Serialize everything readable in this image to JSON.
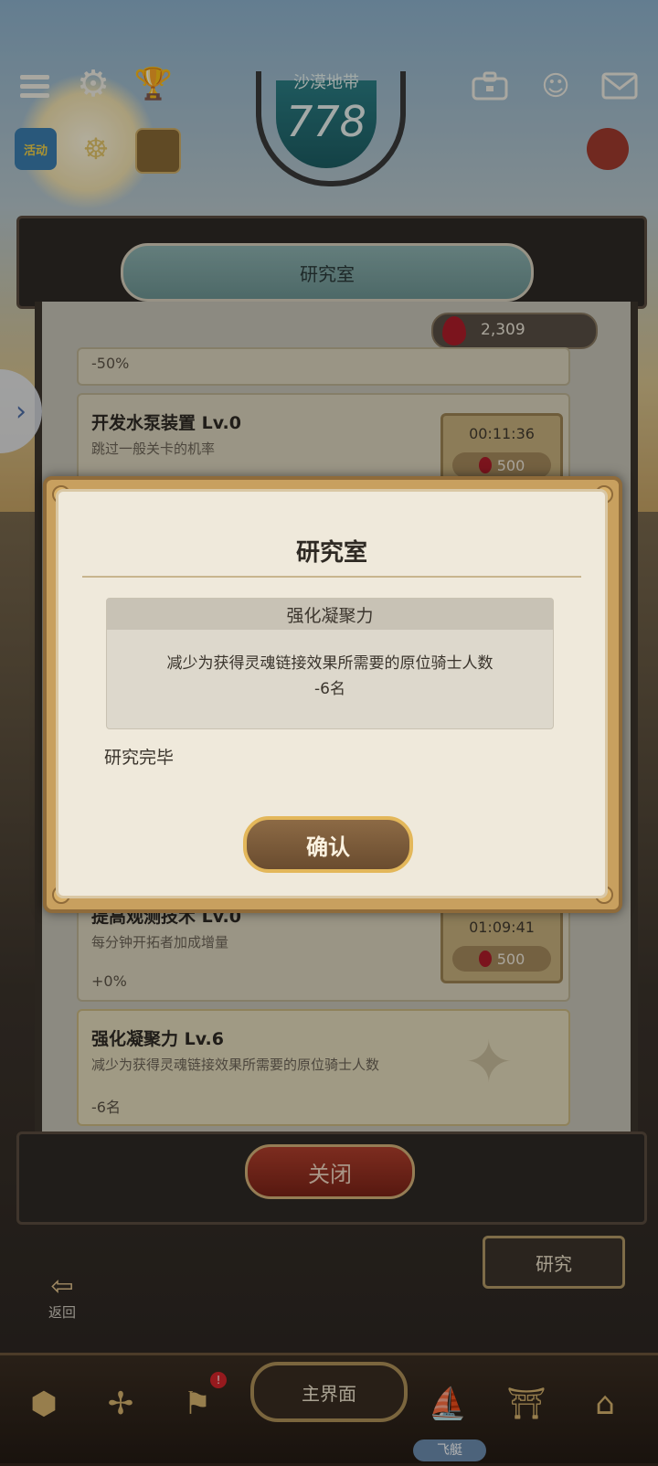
{
  "zone": {
    "name": "沙漠地带",
    "level": "778"
  },
  "top_icons": {
    "menu": "menu-icon",
    "settings": "gear-icon",
    "trophy": "trophy-icon",
    "toolbox": "toolbox-icon",
    "friends": "friends-icon",
    "mail": "mail-icon"
  },
  "event_label": "活动",
  "lab": {
    "title": "研究室",
    "currency": "2,309",
    "items": [
      {
        "value": "-50%"
      },
      {
        "title": "开发水泵装置 Lv.0",
        "desc": "跳过一般关卡的机率",
        "timer": "00:11:36",
        "cost": "500"
      },
      {
        "title": "提高观测技术 Lv.0",
        "desc": "每分钟开拓者加成增量",
        "value": "+0%",
        "timer": "01:09:41",
        "cost": "500"
      },
      {
        "title": "强化凝聚力 Lv.6",
        "desc": "减少为获得灵魂链接效果所需要的原位骑士人数",
        "value": "-6名"
      }
    ],
    "close_label": "关闭"
  },
  "modal": {
    "title": "研究室",
    "effect_title": "强化凝聚力",
    "effect_desc": "减少为获得灵魂链接效果所需要的原位骑士人数",
    "effect_value": "-6名",
    "status": "研究完毕",
    "confirm_label": "确认"
  },
  "bottom": {
    "back_label": "返回",
    "research_label": "研究",
    "main_label": "主界面",
    "airship_label": "飞艇",
    "nav_icons": [
      "guild-icon",
      "propeller-icon",
      "banner-icon",
      "airship-icon",
      "gate-icon",
      "shop-icon"
    ]
  },
  "colors": {
    "accent": "#e3b75a",
    "gem": "#b01e2a",
    "close": "#b3402d"
  }
}
